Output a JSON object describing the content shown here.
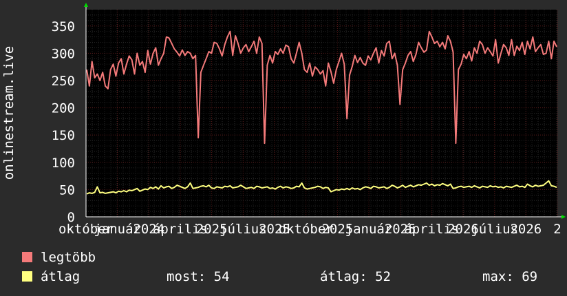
{
  "chart_data": {
    "type": "line",
    "ylabel": "onlinestream.live",
    "ylim": [
      0,
      380
    ],
    "yticks": [
      0,
      50,
      100,
      150,
      200,
      250,
      300,
      350
    ],
    "grid": true,
    "x_tick_labels": [
      "október",
      "január",
      "2024",
      "április",
      "2025",
      "július",
      "2025",
      "október",
      "2025",
      "január",
      "2025",
      "április",
      "2026",
      "július",
      "2026",
      "2"
    ],
    "colors": {
      "background": "#2b2b2b",
      "plot": "#000000",
      "grid_major": "#5a1a1a",
      "grid_minor": "#262626",
      "axis": "#ffffff",
      "arrow": "#00e000"
    },
    "series": [
      {
        "name": "legtöbb",
        "color": "#f47a7a",
        "values": [
          270,
          240,
          285,
          255,
          262,
          250,
          265,
          240,
          235,
          270,
          280,
          258,
          282,
          290,
          262,
          280,
          295,
          288,
          262,
          300,
          278,
          285,
          265,
          305,
          280,
          300,
          310,
          278,
          290,
          300,
          330,
          328,
          318,
          308,
          302,
          295,
          306,
          296,
          303,
          300,
          290,
          296,
          145,
          265,
          278,
          290,
          303,
          300,
          320,
          318,
          308,
          295,
          316,
          330,
          340,
          296,
          332,
          318,
          300,
          310,
          316,
          303,
          312,
          322,
          300,
          330,
          318,
          135,
          278,
          296,
          282,
          303,
          298,
          308,
          300,
          315,
          312,
          290,
          282,
          300,
          320,
          300,
          270,
          265,
          282,
          258,
          275,
          270,
          262,
          268,
          240,
          282,
          266,
          245,
          270,
          285,
          300,
          280,
          180,
          260,
          276,
          296,
          283,
          292,
          282,
          278,
          295,
          288,
          300,
          310,
          282,
          305,
          295,
          318,
          322,
          290,
          300,
          278,
          206,
          270,
          282,
          296,
          303,
          285,
          298,
          320,
          310,
          302,
          306,
          340,
          330,
          318,
          322,
          312,
          320,
          308,
          332,
          322,
          302,
          135,
          270,
          280,
          298,
          290,
          303,
          286,
          310,
          300,
          322,
          316,
          300,
          310,
          303,
          295,
          325,
          282,
          300,
          316,
          310,
          296,
          325,
          296,
          313,
          305,
          320,
          298,
          322,
          308,
          330,
          303,
          310,
          316,
          298,
          300,
          322,
          290,
          322,
          312
        ]
      },
      {
        "name": "átlag",
        "color": "#ffff80",
        "values": [
          42,
          44,
          43,
          45,
          55,
          44,
          45,
          43,
          44,
          45,
          46,
          44,
          47,
          46,
          48,
          46,
          49,
          48,
          50,
          52,
          47,
          49,
          51,
          50,
          54,
          52,
          55,
          51,
          57,
          53,
          55,
          56,
          52,
          54,
          58,
          56,
          54,
          52,
          55,
          62,
          52,
          53,
          54,
          56,
          57,
          55,
          58,
          53,
          52,
          55,
          54,
          53,
          56,
          55,
          57,
          53,
          54,
          55,
          58,
          55,
          52,
          53,
          54,
          52,
          56,
          55,
          53,
          54,
          55,
          52,
          53,
          51,
          54,
          56,
          53,
          55,
          54,
          52,
          53,
          56,
          55,
          62,
          53,
          51,
          52,
          53,
          54,
          56,
          55,
          52,
          54,
          53,
          46,
          48,
          50,
          49,
          51,
          50,
          52,
          50,
          53,
          51,
          52,
          50,
          53,
          55,
          54,
          52,
          56,
          55,
          53,
          54,
          55,
          52,
          54,
          58,
          56,
          53,
          55,
          58,
          54,
          56,
          58,
          55,
          57,
          59,
          58,
          60,
          62,
          58,
          60,
          57,
          59,
          58,
          61,
          59,
          57,
          60,
          52,
          53,
          55,
          56,
          54,
          55,
          56,
          54,
          57,
          55,
          53,
          56,
          55,
          54,
          57,
          55,
          56,
          54,
          55,
          53,
          56,
          55,
          54,
          56,
          58,
          55,
          56,
          54,
          60,
          57,
          55,
          58,
          56,
          57,
          58,
          62,
          66,
          57,
          56,
          54
        ]
      }
    ]
  },
  "legend": {
    "items": [
      {
        "label": "legtöbb",
        "color": "#f47a7a"
      },
      {
        "label": "átlag",
        "color": "#ffff80"
      }
    ],
    "stats": {
      "now": "most: 54",
      "avg": "átlag: 52",
      "max": "max: 69"
    }
  }
}
